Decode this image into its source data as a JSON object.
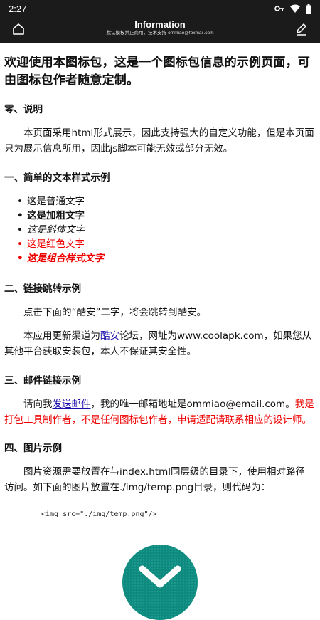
{
  "status": {
    "time": "2:27",
    "icons": [
      "key-icon",
      "wifi-icon",
      "battery-icon"
    ]
  },
  "appbar": {
    "title": "Information",
    "subtitle": "默认模板禁止商用，技术支持-ommiao@foxmail.com",
    "home_icon": "home-icon",
    "edit_icon": "edit-icon"
  },
  "intro": "欢迎使用本图标包，这是一个图标包信息的示例页面，可由图标包作者随意定制。",
  "sections": {
    "s0": {
      "heading": "零、说明",
      "body": "本页面采用html形式展示，因此支持强大的自定义功能，但是本页面只为展示信息所用，因此js脚本可能无效或部分无效。"
    },
    "s1": {
      "heading": "一、简单的文本样式示例",
      "items": [
        "这是普通文字",
        "这是加粗文字",
        "这是斜体文字",
        "这是红色文字",
        "这是组合样式文字"
      ]
    },
    "s2": {
      "heading": "二、链接跳转示例",
      "p1": "点击下面的“酷安”二字，将会跳转到酷安。",
      "p2_before": "本应用更新渠道为",
      "p2_link": "酷安",
      "p2_after": "论坛，网址为www.coolapk.com，如果您从其他平台获取安装包，本人不保证其安全性。"
    },
    "s3": {
      "heading": "三、邮件链接示例",
      "before": "请向我",
      "link": "发送邮件",
      "after": "，我的唯一邮箱地址是ommiao@email.com。",
      "red": "我是打包工具制作者，不是任何图标包作者，申请适配请联系相应的设计师。"
    },
    "s4": {
      "heading": "四、图片示例",
      "body": "图片资源需要放置在与index.html同层级的目录下，使用相对路径访问。如下面的图片放置在./img/temp.png目录，则代码为：",
      "code": "<img src=\"./img/temp.png\"/>"
    }
  },
  "colors": {
    "bar": "#1b1b1b",
    "red": "#e00000",
    "link": "#1a0dab",
    "logo": "#0f8a7e"
  }
}
